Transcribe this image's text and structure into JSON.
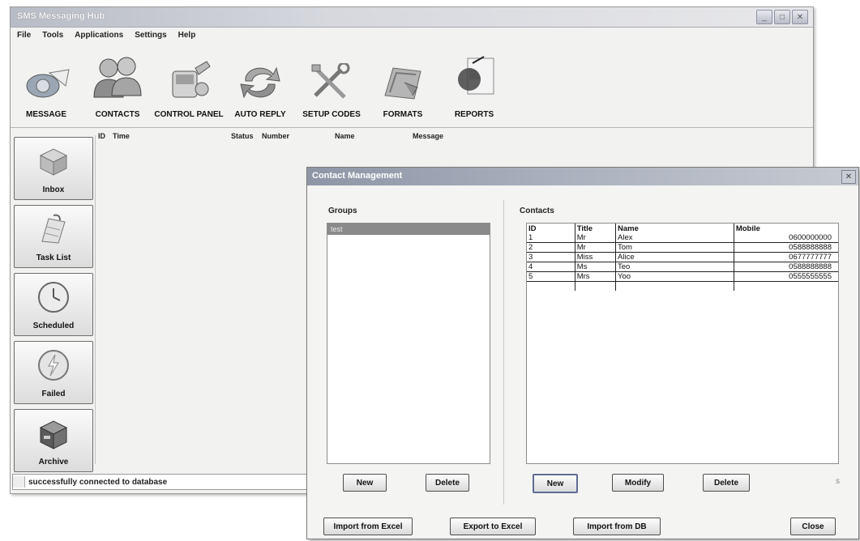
{
  "app": {
    "title": "SMS Messaging Hub",
    "window_buttons": [
      "_",
      "□",
      "✕"
    ]
  },
  "menu": [
    "File",
    "Tools",
    "Applications",
    "Settings",
    "Help"
  ],
  "toolbar": [
    {
      "label": "MESSAGE",
      "icon": "message-icon"
    },
    {
      "label": "CONTACTS",
      "icon": "contacts-icon"
    },
    {
      "label": "CONTROL PANEL",
      "icon": "control-panel-icon"
    },
    {
      "label": "AUTO REPLY",
      "icon": "auto-reply-icon"
    },
    {
      "label": "SETUP CODES",
      "icon": "setup-codes-icon"
    },
    {
      "label": "FORMATS",
      "icon": "formats-icon"
    },
    {
      "label": "REPORTS",
      "icon": "reports-icon"
    }
  ],
  "list_headers": [
    "ID",
    "Time",
    "Status",
    "Number",
    "Name",
    "Message"
  ],
  "sidebar": [
    {
      "label": "Inbox",
      "icon": "inbox-icon"
    },
    {
      "label": "Task List",
      "icon": "task-list-icon"
    },
    {
      "label": "Scheduled",
      "icon": "clock-icon"
    },
    {
      "label": "Failed",
      "icon": "failed-icon"
    },
    {
      "label": "Archive",
      "icon": "archive-icon"
    }
  ],
  "status_text": "successfully connected to database",
  "dialog": {
    "title": "Contact Management",
    "groups_label": "Groups",
    "contacts_label": "Contacts",
    "groups": [
      "test"
    ],
    "contact_columns": [
      "ID",
      "Title",
      "Name",
      "Mobile"
    ],
    "contacts": [
      {
        "id": "1",
        "title": "Mr",
        "name": "Alex",
        "mobile": "0600000000"
      },
      {
        "id": "2",
        "title": "Mr",
        "name": "Tom",
        "mobile": "0588888888"
      },
      {
        "id": "3",
        "title": "Miss",
        "name": "Alice",
        "mobile": "0677777777"
      },
      {
        "id": "4",
        "title": "Ms",
        "name": "Teo",
        "mobile": "0588888888"
      },
      {
        "id": "5",
        "title": "Mrs",
        "name": "Yoo",
        "mobile": "0555555555"
      }
    ],
    "group_buttons": {
      "new": "New",
      "delete": "Delete"
    },
    "contact_buttons": {
      "new": "New",
      "modify": "Modify",
      "delete": "Delete"
    },
    "side_letter": "s",
    "bottom_buttons": {
      "import_excel": "Import from Excel",
      "export_excel": "Export to Excel",
      "import_db": "Import from DB",
      "close": "Close"
    }
  }
}
